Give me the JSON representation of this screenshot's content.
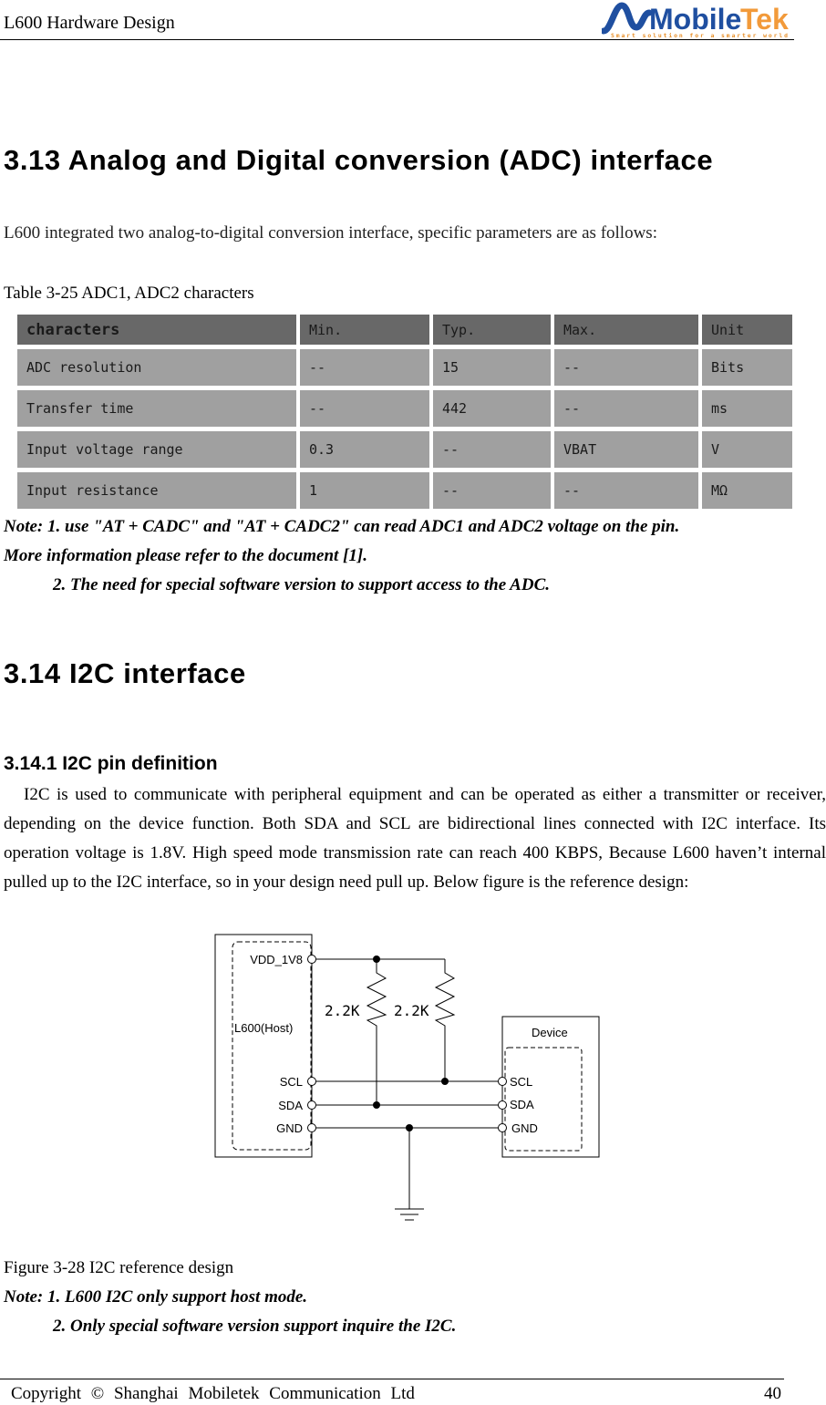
{
  "header": {
    "doc_title": "L600 Hardware Design",
    "logo": {
      "brand_left": "Mobile",
      "brand_right": "Tek",
      "tagline": "Smart solution for a smarter world",
      "brand_blue": "#1f4fa0",
      "brand_orange": "#f29a3a"
    }
  },
  "section_adc": {
    "heading": "3.13 Analog and Digital conversion (ADC) interface",
    "intro": "L600 integrated two analog-to-digital conversion interface, specific parameters are as follows:",
    "table_caption": "Table 3-25 ADC1, ADC2 characters",
    "table": {
      "headers": [
        "characters",
        "Min.",
        "Typ.",
        "Max.",
        "Unit"
      ],
      "rows": [
        [
          "ADC resolution",
          "--",
          "15",
          "--",
          "Bits"
        ],
        [
          "Transfer time",
          "--",
          "442",
          "--",
          "ms"
        ],
        [
          "Input voltage range",
          "0.3",
          "--",
          "VBAT",
          "V"
        ],
        [
          "Input resistance",
          "1",
          "--",
          "--",
          "MΩ"
        ]
      ],
      "header_bg": "#686868",
      "cell_bg": "#a0a0a0"
    },
    "notes": [
      "Note: 1. use \"AT + CADC\" and \"AT + CADC2\" can read ADC1 and ADC2 voltage on the pin.",
      "More information please refer to the document [1].",
      "2. The need for special software version to support access to the ADC."
    ]
  },
  "section_i2c": {
    "heading": "3.14 I2C interface",
    "subheading": "3.14.1 I2C pin definition",
    "body": "I2C is used to communicate with peripheral equipment and can be operated as either a transmitter or receiver, depending on the device function. Both SDA and SCL are bidirectional lines connected with I2C interface. Its operation voltage is 1.8V. High speed mode transmission rate can reach 400 KBPS, Because L600 haven’t internal pulled up to the I2C interface, so in your design need pull up. Below figure is the reference design:",
    "diagram": {
      "host_label": "L600(Host)",
      "device_label": "Device",
      "host_pins": [
        "VDD_1V8",
        "SCL",
        "SDA",
        "GND"
      ],
      "device_pins": [
        "SCL",
        "SDA",
        "GND"
      ],
      "resistors": [
        "2.2K",
        "2.2K"
      ]
    },
    "figure_caption": "Figure 3-28 I2C reference design",
    "notes": [
      "Note: 1. L600 I2C only support host mode.",
      "2. Only special software version support inquire the I2C."
    ]
  },
  "footer": {
    "copyright": "Copyright © Shanghai Mobiletek Communication Ltd",
    "page_number": "40"
  }
}
